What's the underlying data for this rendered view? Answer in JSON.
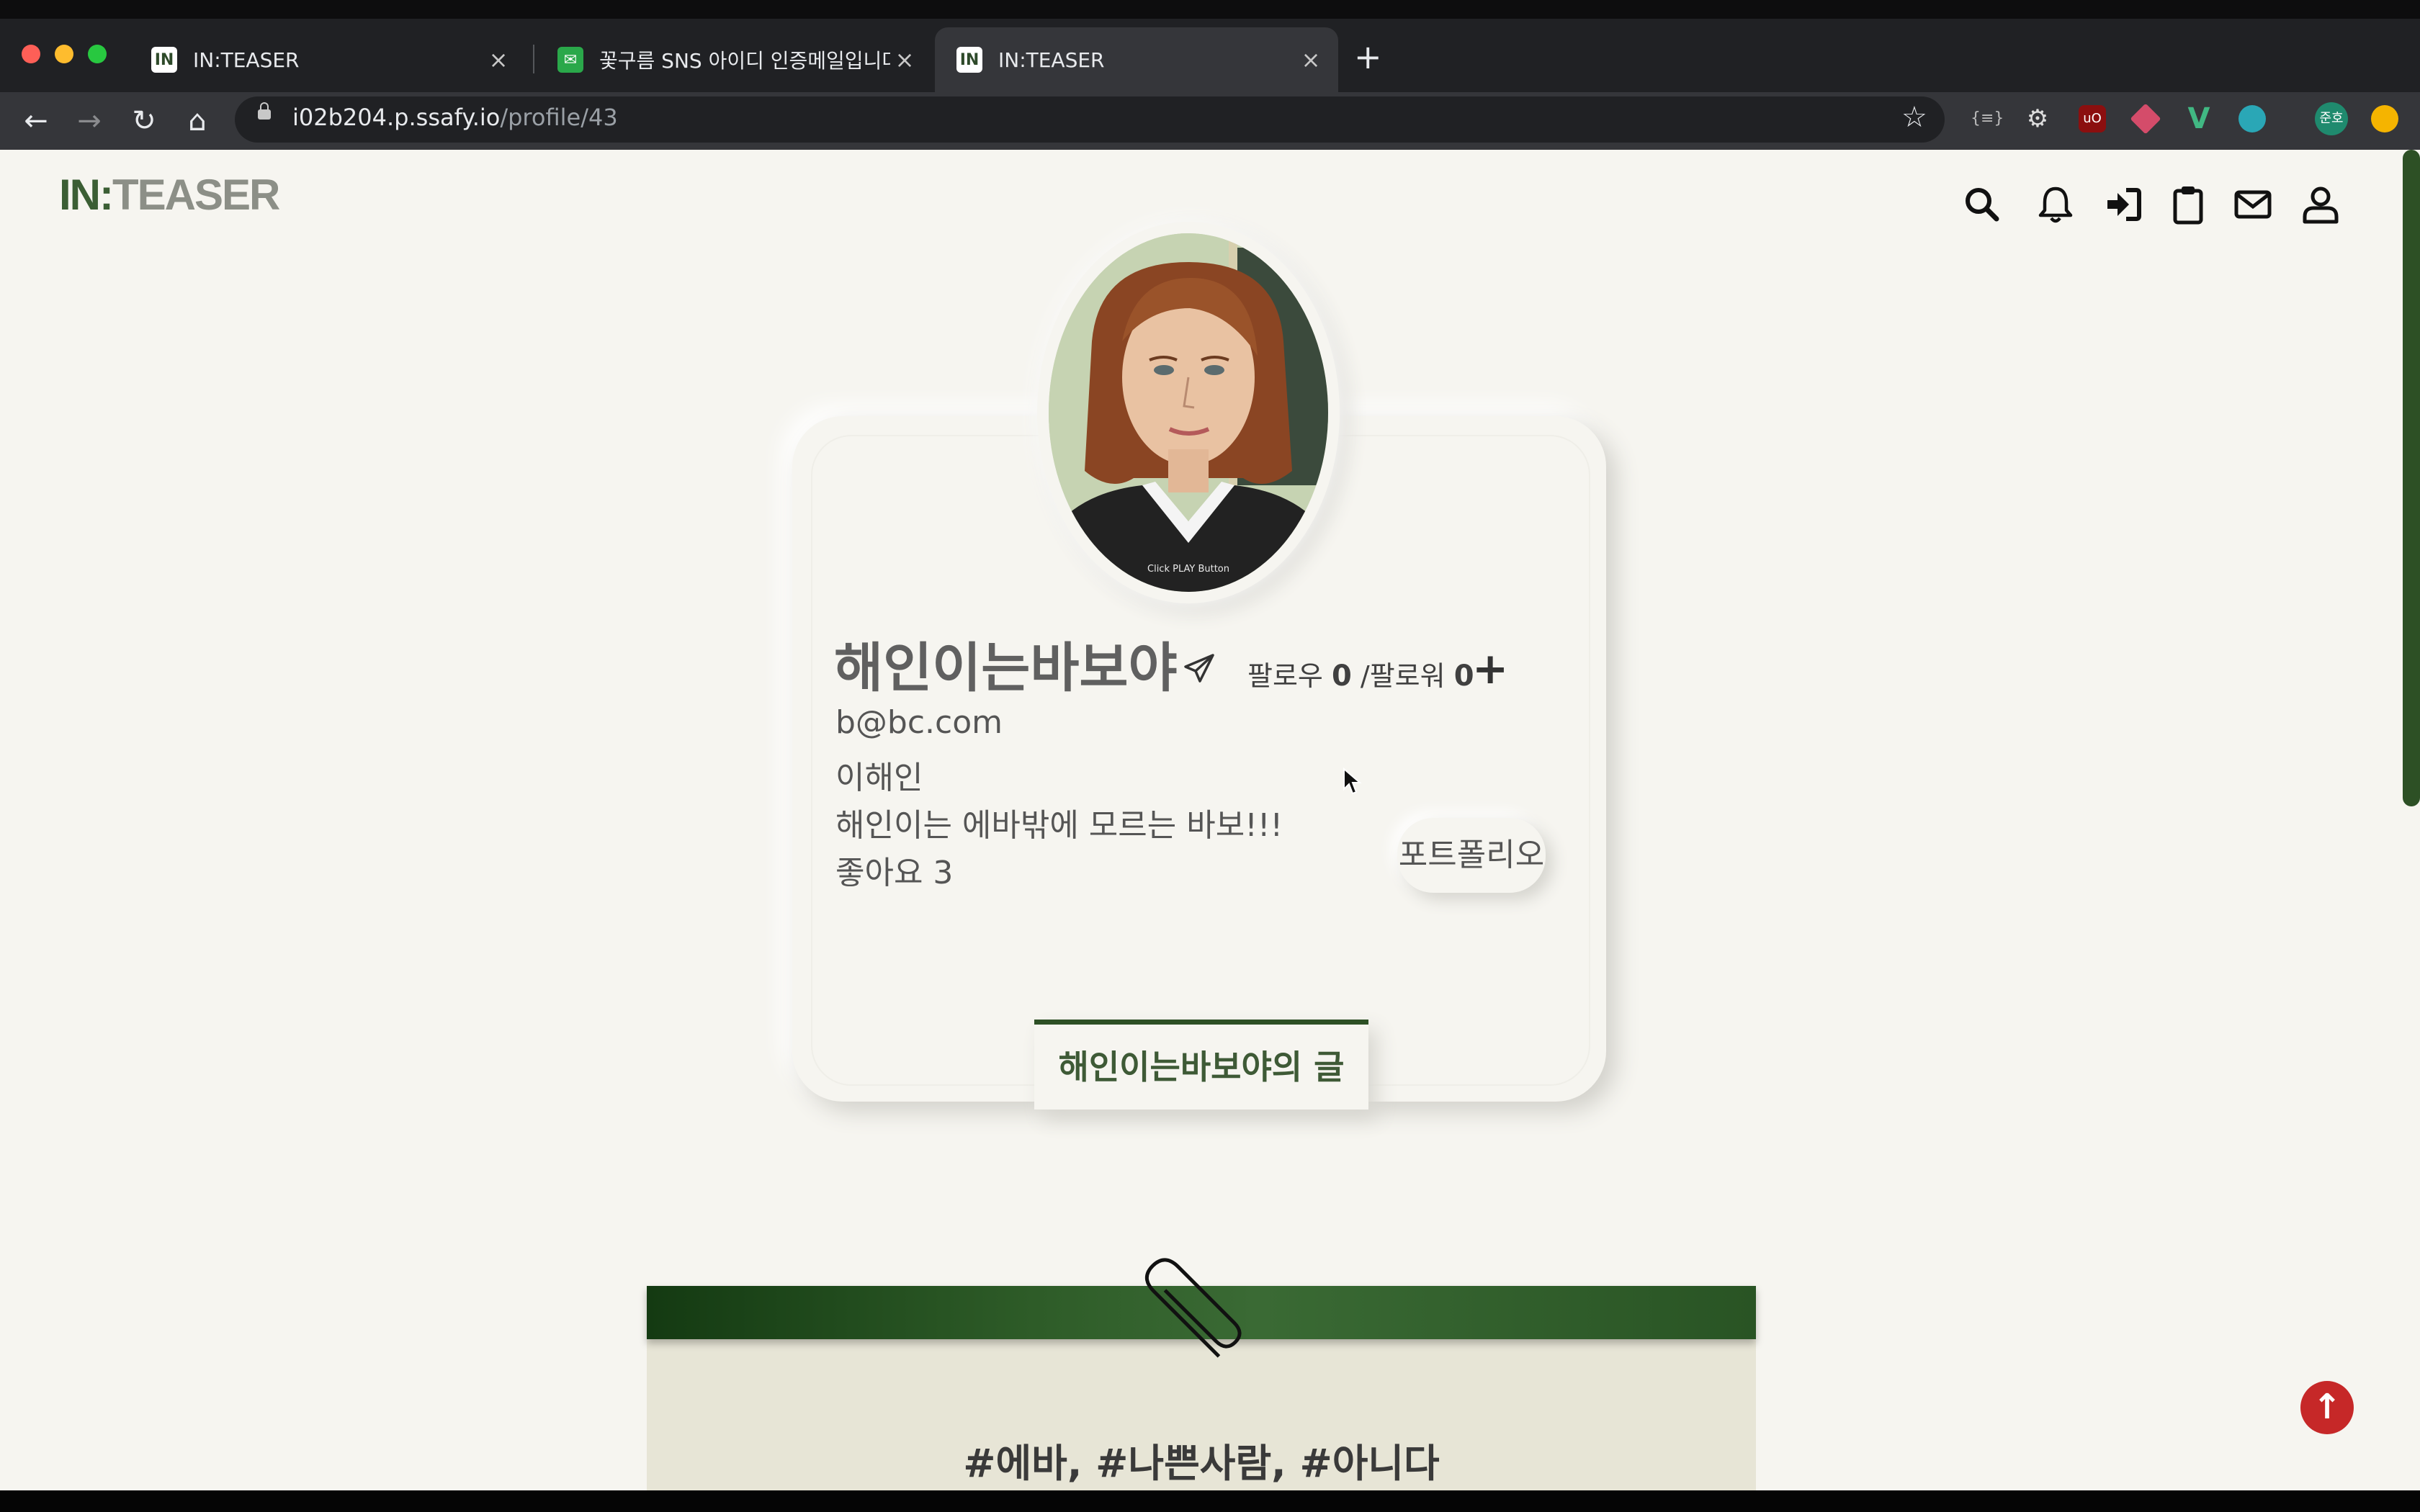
{
  "browser": {
    "tabs": [
      {
        "title": "IN:TEASER",
        "favicon": "inteaser-favicon",
        "active": false
      },
      {
        "title": "꽃구름 SNS 아이디 인증메일입니다.",
        "favicon": "mail-favicon",
        "active": false
      },
      {
        "title": "IN:TEASER",
        "favicon": "inteaser-favicon",
        "active": true
      }
    ],
    "url_host": "i02b204.p.ssafy.io",
    "url_path": "/profile/43",
    "profile_badge": "준호"
  },
  "header": {
    "logo_in": "IN",
    "logo_colon": ":",
    "logo_rest": "TEASER",
    "icons": [
      "search-icon",
      "bell-icon",
      "login-icon",
      "clipboard-icon",
      "mail-icon",
      "user-icon"
    ]
  },
  "profile": {
    "avatar_caption": "Click PLAY Button",
    "nickname": "해인이는바보야",
    "follow_label": "팔로우",
    "following_count": "0",
    "separator": " /",
    "follower_label": "팔로워",
    "follower_count": "0",
    "follow_add": "+",
    "email": "b@bc.com",
    "name": "이해인",
    "bio": "해인이는 에바밖에 모르는 바보!!!",
    "likes": "좋아요 3",
    "portfolio_button": "포트폴리오"
  },
  "posts_tab": {
    "label": "해인이는바보야의 글"
  },
  "post": {
    "tags": "#에바, #나쁜사람, #아니다"
  },
  "colors": {
    "brand_green": "#2d5025",
    "page_bg": "#f6f5f0",
    "scroll_top_red": "#c62828"
  }
}
